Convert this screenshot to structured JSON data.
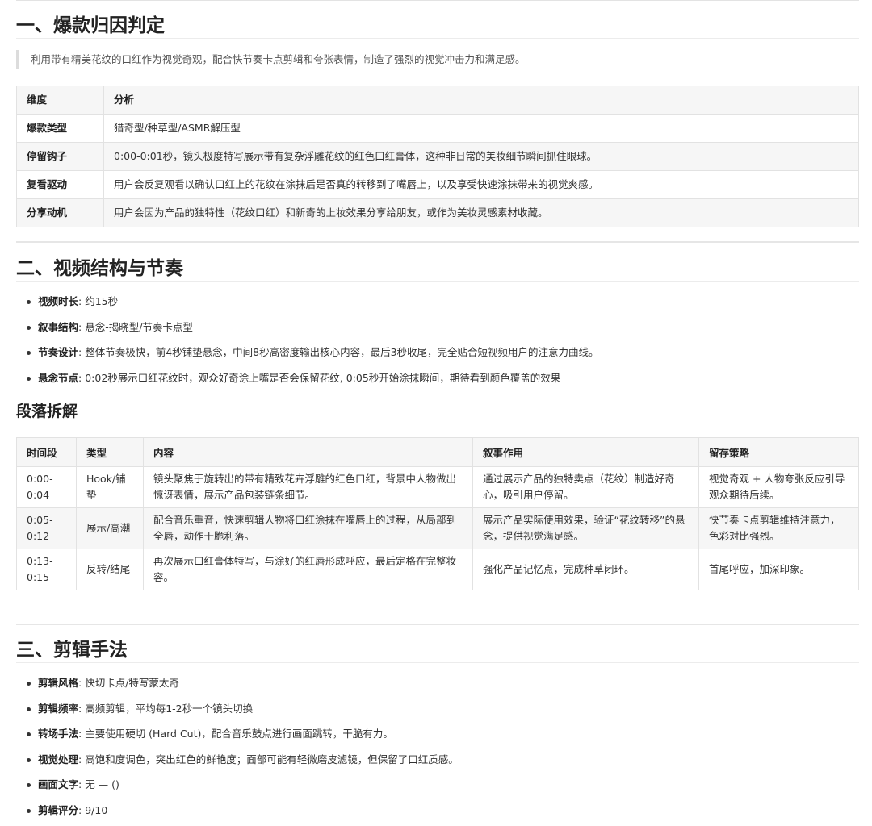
{
  "section1": {
    "heading": "一、爆款归因判定",
    "quote": "利用带有精美花纹的口红作为视觉奇观，配合快节奏卡点剪辑和夸张表情，制造了强烈的视觉冲击力和满足感。",
    "table": {
      "headers": [
        "维度",
        "分析"
      ],
      "rows": [
        [
          "爆款类型",
          "猎奇型/种草型/ASMR解压型"
        ],
        [
          "停留钩子",
          "0:00-0:01秒，镜头极度特写展示带有复杂浮雕花纹的红色口红膏体，这种非日常的美妆细节瞬间抓住眼球。"
        ],
        [
          "复看驱动",
          "用户会反复观看以确认口红上的花纹在涂抹后是否真的转移到了嘴唇上，以及享受快速涂抹带来的视觉爽感。"
        ],
        [
          "分享动机",
          "用户会因为产品的独特性（花纹口红）和新奇的上妆效果分享给朋友，或作为美妆灵感素材收藏。"
        ]
      ]
    }
  },
  "section2": {
    "heading": "二、视频结构与节奏",
    "bullets": [
      {
        "label": "视频时长",
        "text": ": 约15秒"
      },
      {
        "label": "叙事结构",
        "text": ": 悬念-揭晓型/节奏卡点型"
      },
      {
        "label": "节奏设计",
        "text": ": 整体节奏极快，前4秒铺垫悬念，中间8秒高密度输出核心内容，最后3秒收尾，完全贴合短视频用户的注意力曲线。"
      },
      {
        "label": "悬念节点",
        "text": ": 0:02秒展示口红花纹时，观众好奇涂上嘴是否会保留花纹, 0:05秒开始涂抹瞬间，期待看到颜色覆盖的效果"
      }
    ],
    "subheading": "段落拆解",
    "table": {
      "headers": [
        "时间段",
        "类型",
        "内容",
        "叙事作用",
        "留存策略"
      ],
      "rows": [
        [
          "0:00-0:04",
          "Hook/铺垫",
          "镜头聚焦于旋转出的带有精致花卉浮雕的红色口红，背景中人物做出惊讶表情，展示产品包装链条细节。",
          "通过展示产品的独特卖点（花纹）制造好奇心，吸引用户停留。",
          "视觉奇观 + 人物夸张反应引导观众期待后续。"
        ],
        [
          "0:05-0:12",
          "展示/高潮",
          "配合音乐重音，快速剪辑人物将口红涂抹在嘴唇上的过程，从局部到全唇，动作干脆利落。",
          "展示产品实际使用效果，验证“花纹转移”的悬念，提供视觉满足感。",
          "快节奏卡点剪辑维持注意力，色彩对比强烈。"
        ],
        [
          "0:13-0:15",
          "反转/结尾",
          "再次展示口红膏体特写，与涂好的红唇形成呼应，最后定格在完整妆容。",
          "强化产品记忆点，完成种草闭环。",
          "首尾呼应，加深印象。"
        ]
      ]
    }
  },
  "section3": {
    "heading": "三、剪辑手法",
    "bullets": [
      {
        "label": "剪辑风格",
        "text": ": 快切卡点/特写蒙太奇"
      },
      {
        "label": "剪辑频率",
        "text": ": 高频剪辑，平均每1-2秒一个镜头切换"
      },
      {
        "label": "转场手法",
        "text": ": 主要使用硬切 (Hard Cut)，配合音乐鼓点进行画面跳转，干脆有力。"
      },
      {
        "label": "视觉处理",
        "text": ": 高饱和度调色，突出红色的鲜艳度；面部可能有轻微磨皮滤镜，但保留了口红质感。"
      },
      {
        "label": "画面文字",
        "text": ": 无 — ()"
      },
      {
        "label": "剪辑评分",
        "text": ": 9/10"
      }
    ]
  }
}
